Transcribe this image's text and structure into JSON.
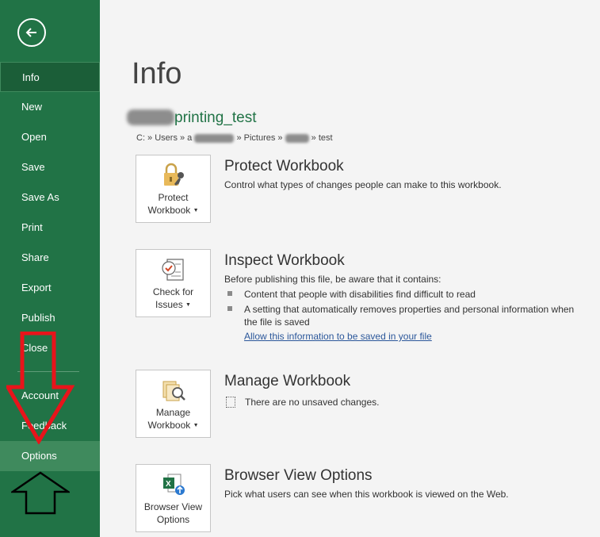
{
  "sidebar": {
    "items": [
      {
        "label": "Info"
      },
      {
        "label": "New"
      },
      {
        "label": "Open"
      },
      {
        "label": "Save"
      },
      {
        "label": "Save As"
      },
      {
        "label": "Print"
      },
      {
        "label": "Share"
      },
      {
        "label": "Export"
      },
      {
        "label": "Publish"
      },
      {
        "label": "Close"
      },
      {
        "label": "Account"
      },
      {
        "label": "Feedback"
      },
      {
        "label": "Options"
      }
    ]
  },
  "main": {
    "title": "Info",
    "file_name": "printing_test",
    "path": {
      "p1": "C: » Users » a",
      "p2": "» Pictures »",
      "p3": "» test"
    },
    "protect": {
      "tile_line1": "Protect",
      "tile_line2": "Workbook",
      "title": "Protect Workbook",
      "desc": "Control what types of changes people can make to this workbook."
    },
    "inspect": {
      "tile_line1": "Check for",
      "tile_line2": "Issues",
      "title": "Inspect Workbook",
      "desc": "Before publishing this file, be aware that it contains:",
      "bullet1": "Content that people with disabilities find difficult to read",
      "bullet2_line1": "A setting that automatically removes properties and personal information when",
      "bullet2_line2": "the file is saved",
      "link": "Allow this information to be saved in your file"
    },
    "manage": {
      "tile_line1": "Manage",
      "tile_line2": "Workbook",
      "title": "Manage Workbook",
      "desc": "There are no unsaved changes."
    },
    "browser": {
      "tile_line1": "Browser View",
      "tile_line2": "Options",
      "title": "Browser View Options",
      "desc": "Pick what users can see when this workbook is viewed on the Web."
    }
  },
  "colors": {
    "brand_green": "#217346",
    "active_item": "#1b5e38",
    "annotation_red": "#e8141b"
  },
  "icons": {
    "back": "back-arrow-icon",
    "protect": "lock-key-icon",
    "inspect": "checklist-icon",
    "manage": "manage-workbook-icon",
    "browser": "browser-view-icon"
  }
}
